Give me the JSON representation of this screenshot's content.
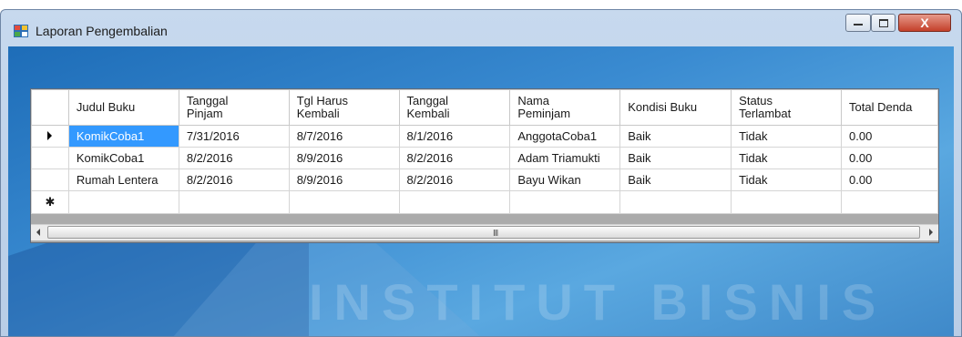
{
  "window": {
    "title": "Laporan Pengembalian",
    "close_glyph": "X"
  },
  "grid": {
    "columns": [
      "Judul Buku",
      "Tanggal\nPinjam",
      "Tgl Harus\nKembali",
      "Tanggal\nKembali",
      "Nama\nPeminjam",
      "Kondisi Buku",
      "Status\nTerlambat",
      "Total Denda"
    ],
    "rows": [
      [
        "KomikCoba1",
        "7/31/2016",
        "8/7/2016",
        "8/1/2016",
        "AnggotaCoba1",
        "Baik",
        "Tidak",
        "0.00"
      ],
      [
        "KomikCoba1",
        "8/2/2016",
        "8/9/2016",
        "8/2/2016",
        "Adam Triamukti",
        "Baik",
        "Tidak",
        "0.00"
      ],
      [
        "Rumah Lentera",
        "8/2/2016",
        "8/9/2016",
        "8/2/2016",
        "Bayu Wikan",
        "Baik",
        "Tidak",
        "0.00"
      ]
    ],
    "new_row_glyph": "✱",
    "scroll_grip": "III"
  },
  "watermark": "INSTITUT BISNIS",
  "colors": {
    "selection": "#3399ff",
    "close": "#c4402a"
  }
}
